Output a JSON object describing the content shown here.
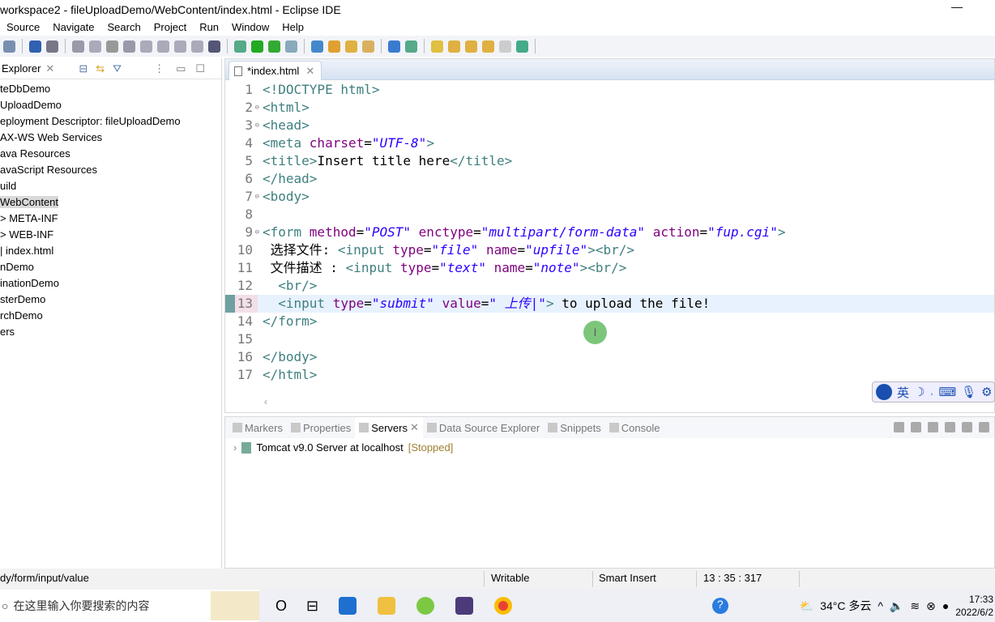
{
  "window": {
    "title": "workspace2 - fileUploadDemo/WebContent/index.html - Eclipse IDE",
    "min": "—"
  },
  "menu": [
    "Source",
    "Navigate",
    "Search",
    "Project",
    "Run",
    "Window",
    "Help"
  ],
  "toolbar_icons": [
    "save-all",
    "terminal",
    "skip-breakpoints",
    "resume",
    "suspend",
    "terminate",
    "disconnect",
    "step-into",
    "step-over",
    "step-return",
    "drop-to-frame",
    "use-step-filters",
    "debug",
    "run",
    "run-server",
    "new-server",
    "new-service",
    "open-type",
    "open-resource",
    "search-link",
    "web-browser",
    "pin",
    "next-annotation",
    "previous-annotation",
    "last-edit",
    "back",
    "forward",
    "open-perspective"
  ],
  "explorer": {
    "title": "Explorer",
    "items": [
      {
        "label": "teDbDemo",
        "indent": 0
      },
      {
        "label": "UploadDemo",
        "indent": 0
      },
      {
        "label": "eployment Descriptor: fileUploadDemo",
        "indent": 0
      },
      {
        "label": "AX-WS Web Services",
        "indent": 0
      },
      {
        "label": "ava Resources",
        "indent": 0
      },
      {
        "label": "avaScript Resources",
        "indent": 0
      },
      {
        "label": "uild",
        "indent": 0
      },
      {
        "label": "WebContent",
        "indent": 0,
        "selected": true
      },
      {
        "label": "> META-INF",
        "indent": 1
      },
      {
        "label": "> WEB-INF",
        "indent": 1
      },
      {
        "label": "| index.html",
        "indent": 1
      },
      {
        "label": "nDemo",
        "indent": 0
      },
      {
        "label": "inationDemo",
        "indent": 0
      },
      {
        "label": "sterDemo",
        "indent": 0
      },
      {
        "label": "rchDemo",
        "indent": 0
      },
      {
        "label": "ers",
        "indent": 0
      }
    ]
  },
  "editor": {
    "tab": "*index.html",
    "current_line": 13,
    "lines": [
      {
        "n": "1",
        "tokens": [
          [
            "tag",
            "<!DOCTYPE html>"
          ]
        ]
      },
      {
        "n": "2",
        "fold": true,
        "tokens": [
          [
            "tag",
            "<html>"
          ]
        ]
      },
      {
        "n": "3",
        "fold": true,
        "tokens": [
          [
            "tag",
            "<head>"
          ]
        ]
      },
      {
        "n": "4",
        "tokens": [
          [
            "tag",
            "<meta "
          ],
          [
            "attr",
            "charset"
          ],
          [
            "txt",
            "="
          ],
          [
            "val",
            "\"UTF-8\""
          ],
          [
            "tag",
            ">"
          ]
        ]
      },
      {
        "n": "5",
        "tokens": [
          [
            "tag",
            "<title>"
          ],
          [
            "txt",
            "Insert title here"
          ],
          [
            "tag",
            "</title>"
          ]
        ]
      },
      {
        "n": "6",
        "tokens": [
          [
            "tag",
            "</head>"
          ]
        ]
      },
      {
        "n": "7",
        "fold": true,
        "tokens": [
          [
            "tag",
            "<body>"
          ]
        ]
      },
      {
        "n": "8",
        "tokens": []
      },
      {
        "n": "9",
        "fold": true,
        "tokens": [
          [
            "tag",
            "<form "
          ],
          [
            "attr",
            "method"
          ],
          [
            "txt",
            "="
          ],
          [
            "val",
            "\"POST\""
          ],
          [
            "txt",
            " "
          ],
          [
            "attr",
            "enctype"
          ],
          [
            "txt",
            "="
          ],
          [
            "val",
            "\"multipart/form-data\""
          ],
          [
            "txt",
            " "
          ],
          [
            "attr",
            "action"
          ],
          [
            "txt",
            "="
          ],
          [
            "val",
            "\"fup.cgi\""
          ],
          [
            "tag",
            ">"
          ]
        ]
      },
      {
        "n": "10",
        "tokens": [
          [
            "txt",
            " 选择文件: "
          ],
          [
            "tag",
            "<input "
          ],
          [
            "attr",
            "type"
          ],
          [
            "txt",
            "="
          ],
          [
            "val",
            "\"file\""
          ],
          [
            "txt",
            " "
          ],
          [
            "attr",
            "name"
          ],
          [
            "txt",
            "="
          ],
          [
            "val",
            "\"upfile\""
          ],
          [
            "tag",
            "><br/>"
          ]
        ]
      },
      {
        "n": "11",
        "tokens": [
          [
            "txt",
            " 文件描述 : "
          ],
          [
            "tag",
            "<input "
          ],
          [
            "attr",
            "type"
          ],
          [
            "txt",
            "="
          ],
          [
            "val",
            "\"text\""
          ],
          [
            "txt",
            " "
          ],
          [
            "attr",
            "name"
          ],
          [
            "txt",
            "="
          ],
          [
            "val",
            "\"note\""
          ],
          [
            "tag",
            "><br/>"
          ]
        ]
      },
      {
        "n": "12",
        "tokens": [
          [
            "txt",
            "  "
          ],
          [
            "tag",
            "<br/>"
          ]
        ]
      },
      {
        "n": "13",
        "tokens": [
          [
            "txt",
            "  "
          ],
          [
            "tag",
            "<input "
          ],
          [
            "attr",
            "type"
          ],
          [
            "txt",
            "="
          ],
          [
            "val",
            "\"submit\""
          ],
          [
            "txt",
            " "
          ],
          [
            "attr",
            "value"
          ],
          [
            "txt",
            "="
          ],
          [
            "val",
            "\" 上传|\""
          ],
          [
            "tag",
            ">"
          ],
          [
            "txt",
            " to upload the file!"
          ]
        ]
      },
      {
        "n": "14",
        "tokens": [
          [
            "tag",
            "</form>"
          ]
        ]
      },
      {
        "n": "15",
        "tokens": []
      },
      {
        "n": "16",
        "tokens": [
          [
            "tag",
            "</body>"
          ]
        ]
      },
      {
        "n": "17",
        "tokens": [
          [
            "tag",
            "</html>"
          ]
        ]
      }
    ]
  },
  "ime": {
    "label": "英"
  },
  "bottom": {
    "tabs": [
      "Markers",
      "Properties",
      "Servers",
      "Data Source Explorer",
      "Snippets",
      "Console"
    ],
    "active": "Servers",
    "server": {
      "name": "Tomcat v9.0 Server at localhost",
      "state": "[Stopped]"
    }
  },
  "status": {
    "path": "dy/form/input/value",
    "mode": "Writable",
    "insert": "Smart Insert",
    "position": "13 : 35 : 317"
  },
  "taskbar": {
    "search_placeholder": "在这里输入你要搜索的内容",
    "weather": "34°C 多云",
    "time": "17:33",
    "date": "2022/6/2"
  },
  "colors": {
    "tag": "#3f7f7f",
    "attr": "#7f007f",
    "value": "#2a00ff",
    "current_line": "#e8f2fe"
  }
}
